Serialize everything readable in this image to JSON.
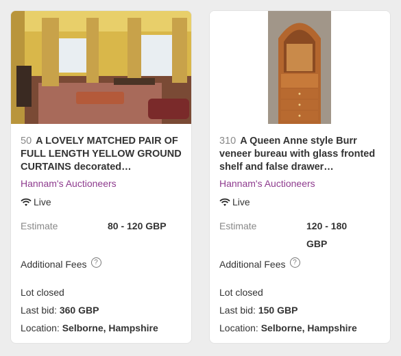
{
  "lots": [
    {
      "lot_number": "50",
      "title": "A LOVELY MATCHED PAIR OF FULL LENGTH YELLOW GROUND CURTAINS decorated…",
      "auctioneer": "Hannam's Auctioneers",
      "live_label": "Live",
      "estimate_label": "Estimate",
      "estimate_value": "80 - 120 GBP",
      "additional_fees_label": "Additional Fees",
      "help_symbol": "?",
      "status": "Lot closed",
      "last_bid_label": "Last bid:",
      "last_bid_value": "360 GBP",
      "location_label": "Location:",
      "location_value": "Selborne, Hampshire"
    },
    {
      "lot_number": "310",
      "title": "A Queen Anne style Burr veneer bureau with glass fronted shelf and false drawer…",
      "auctioneer": "Hannam's Auctioneers",
      "live_label": "Live",
      "estimate_label": "Estimate",
      "estimate_value": "120 - 180 GBP",
      "additional_fees_label": "Additional Fees",
      "help_symbol": "?",
      "status": "Lot closed",
      "last_bid_label": "Last bid:",
      "last_bid_value": "150 GBP",
      "location_label": "Location:",
      "location_value": "Selborne, Hampshire"
    }
  ],
  "colors": {
    "auctioneer_link": "#8e3b8e",
    "muted_text": "#888888",
    "card_background": "#ffffff",
    "page_background": "#ededed"
  },
  "icons": {
    "live": "wifi-signal-icon",
    "help": "question-circle-icon"
  }
}
